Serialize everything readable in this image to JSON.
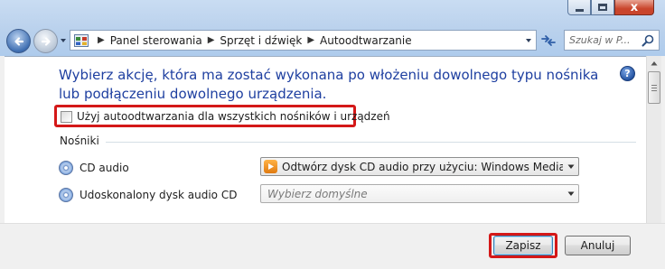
{
  "window": {
    "minimize_icon": "minimize-icon",
    "maximize_icon": "maximize-icon",
    "close_icon": "close-icon",
    "close_label": "x"
  },
  "nav": {
    "back_icon": "back-arrow-icon",
    "forward_icon": "forward-arrow-icon"
  },
  "address": {
    "crumbs": [
      "Panel sterowania",
      "Sprzęt i dźwięk",
      "Autoodtwarzanie"
    ],
    "separator": "▶",
    "dropdown_glyph": "▼",
    "refresh_glyph": "⟳"
  },
  "search": {
    "placeholder": "Szukaj w P..."
  },
  "main": {
    "heading": "Wybierz akcję, która ma zostać wykonana po włożeniu dowolnego typu nośnika lub podłączeniu dowolnego urządzenia.",
    "help_label": "?",
    "use_autoplay_label": "Użyj autoodtwarzania dla wszystkich nośników i urządzeń",
    "use_autoplay_checked": false,
    "section_label": "Nośniki",
    "devices": [
      {
        "label": "CD audio",
        "value": "Odtwórz dysk CD audio przy użyciu: Windows Media Player",
        "placeholder": false
      },
      {
        "label": "Udoskonalony dysk audio CD",
        "value": "Wybierz domyślne",
        "placeholder": true
      }
    ]
  },
  "footer": {
    "save_label": "Zapisz",
    "cancel_label": "Anuluj"
  },
  "colors": {
    "heading": "#1e3fa0",
    "highlight": "#d41818"
  }
}
